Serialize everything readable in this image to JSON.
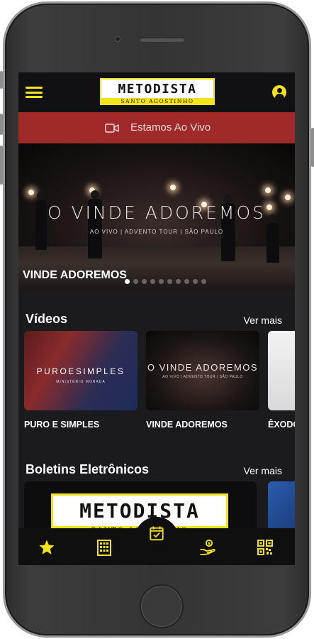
{
  "app": {
    "logo_title": "METODISTA",
    "logo_subtitle": "SANTO AGOSTINHO"
  },
  "live_bar": {
    "label": "Estamos Ao Vivo",
    "icon": "video-camera-icon"
  },
  "banner": {
    "image_title": "O VINDE ADOREMOS",
    "image_subtitle": "AO VIVO | ADVENTO TOUR | SÃO PAULO",
    "caption": "VINDE ADOREMOS",
    "slide_count": 10,
    "active_slide": 1
  },
  "videos": {
    "title": "Vídeos",
    "see_more": "Ver mais",
    "items": [
      {
        "label": "PURO E SIMPLES",
        "thumb_title": "PUROESIMPLES",
        "thumb_subtitle": "MINISTÉRIO MORADA"
      },
      {
        "label": "VINDE ADOREMOS",
        "thumb_title": "O VINDE ADOREMOS",
        "thumb_subtitle": "AO VIVO | ADVENTO TOUR | SÃO PAULO"
      },
      {
        "label": "ÊXODO",
        "thumb_title": "",
        "thumb_subtitle": ""
      }
    ]
  },
  "bulletins": {
    "title": "Boletins Eletrônicos",
    "see_more": "Ver mais",
    "card_logo_title": "METODISTA",
    "card_logo_subtitle": "SANTO AGOSTINHO"
  },
  "tabs": [
    {
      "name": "favorites",
      "icon": "star-icon"
    },
    {
      "name": "calendar",
      "icon": "building-icon"
    },
    {
      "name": "agenda",
      "icon": "calendar-check-icon",
      "active": true
    },
    {
      "name": "donate",
      "icon": "hand-donate-icon"
    },
    {
      "name": "qr-code",
      "icon": "qr-code-icon"
    }
  ],
  "colors": {
    "accent": "#f2e31b",
    "live_bar": "#a02a2a",
    "background": "#1b1b1d",
    "header": "#111113"
  }
}
